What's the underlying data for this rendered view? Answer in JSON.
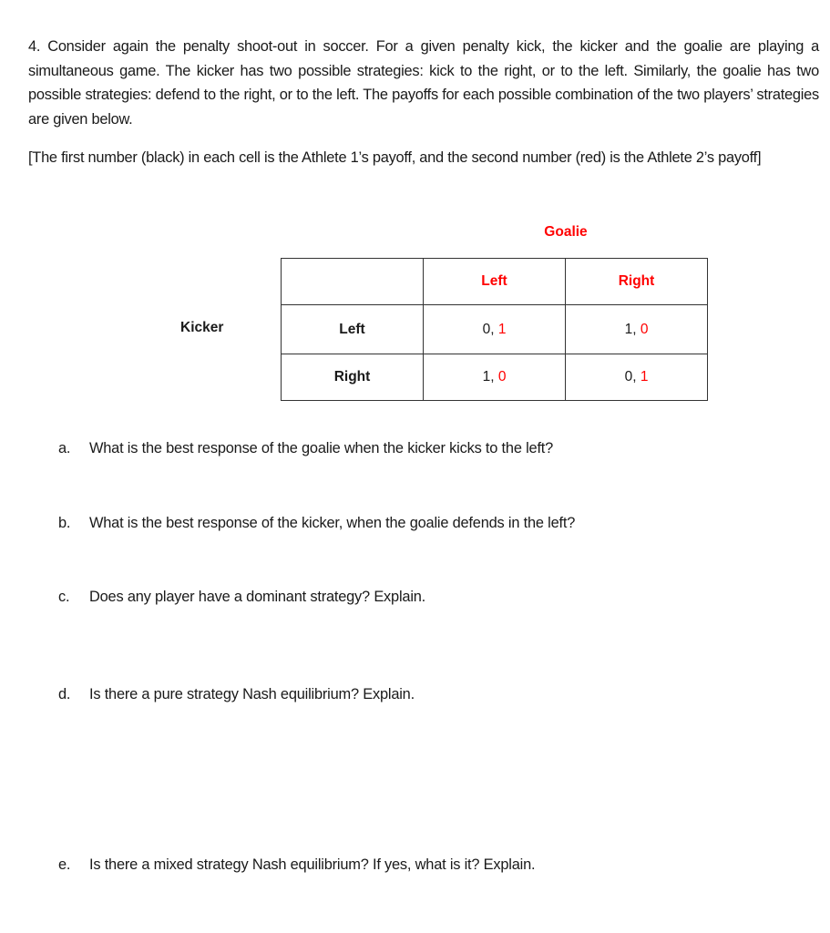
{
  "problem": {
    "intro": "4. Consider again the penalty shoot-out in soccer. For a given penalty kick, the kicker and the goalie are playing a simultaneous game. The kicker has two possible strategies: kick to the right, or to the left. Similarly, the goalie has two possible strategies: defend to the right, or to the left. The payoffs for each possible combination of the two players’ strategies are given below.",
    "note": "[The first number (black) in each cell is the Athlete 1’s payoff, and the second number (red) is the Athlete 2’s payoff]"
  },
  "matrix": {
    "column_player": "Goalie",
    "row_player": "Kicker",
    "column_strategies": [
      "Left",
      "Right"
    ],
    "row_strategies": [
      "Left",
      "Right"
    ],
    "payoffs": [
      [
        {
          "p1": "0",
          "p2": "1"
        },
        {
          "p1": "1",
          "p2": "0"
        }
      ],
      [
        {
          "p1": "1",
          "p2": "0"
        },
        {
          "p1": "0",
          "p2": "1"
        }
      ]
    ],
    "colors": {
      "player1": "#1a1a1a",
      "player2": "#ff0000"
    }
  },
  "questions": [
    {
      "letter": "a.",
      "text": "What is the best response of the goalie when the kicker kicks to the left?"
    },
    {
      "letter": "b.",
      "text": "What is the best response of the kicker, when the goalie defends in the left?"
    },
    {
      "letter": "c.",
      "text": "Does any player have a dominant strategy? Explain."
    },
    {
      "letter": "d.",
      "text": "Is there a pure strategy Nash equilibrium? Explain."
    },
    {
      "letter": "e.",
      "text": "Is there a mixed strategy Nash equilibrium? If yes, what is it? Explain."
    }
  ]
}
